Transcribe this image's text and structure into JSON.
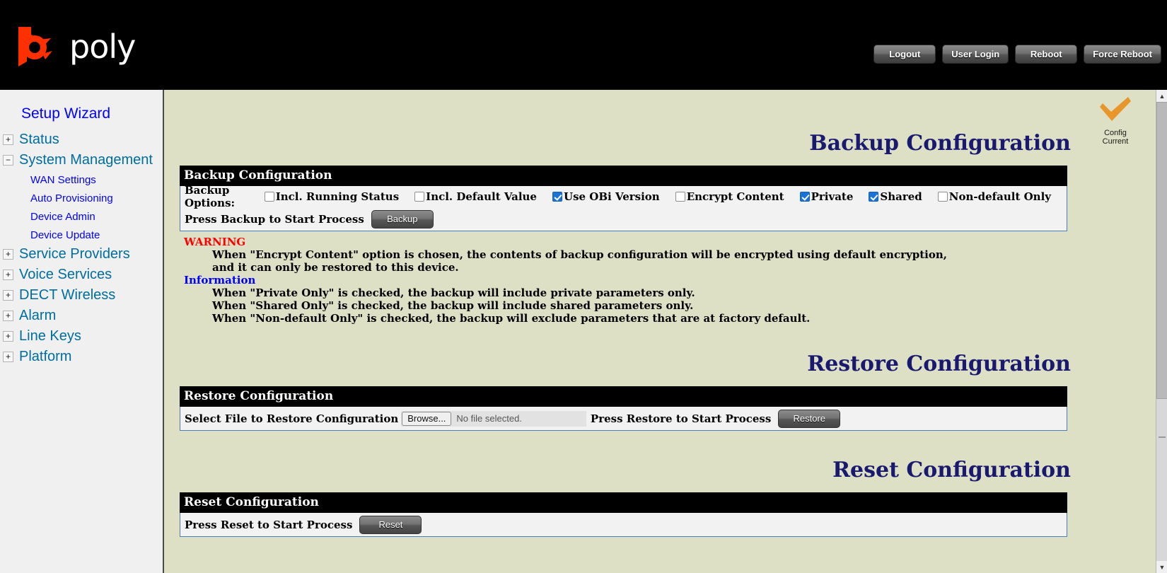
{
  "header": {
    "logo_text": "poly",
    "logo_icon": "poly-logo-icon",
    "buttons": [
      {
        "label": "Logout",
        "name": "logout-button"
      },
      {
        "label": "User Login",
        "name": "user-login-button"
      },
      {
        "label": "Reboot",
        "name": "reboot-button"
      },
      {
        "label": "Force Reboot",
        "name": "force-reboot-button"
      }
    ]
  },
  "sidebar": {
    "wizard": "Setup Wizard",
    "groups": [
      {
        "toggle": "+",
        "label": "Status"
      },
      {
        "toggle": "−",
        "label": "System Management"
      },
      {
        "toggle": "+",
        "label": "Service Providers"
      },
      {
        "toggle": "+",
        "label": "Voice Services"
      },
      {
        "toggle": "+",
        "label": "DECT Wireless"
      },
      {
        "toggle": "+",
        "label": "Alarm"
      },
      {
        "toggle": "+",
        "label": "Line Keys"
      },
      {
        "toggle": "+",
        "label": "Platform"
      }
    ],
    "system_management_items": [
      "WAN Settings",
      "Auto Provisioning",
      "Device Admin",
      "Device Update"
    ]
  },
  "status_badge": {
    "icon": "checkmark-icon",
    "line1": "Config",
    "line2": "Current",
    "color": "#e8962c"
  },
  "backup": {
    "page_title": "Backup Configuration",
    "panel_title": "Backup Configuration",
    "options_label": "Backup Options:",
    "options": [
      {
        "label": "Incl. Running Status",
        "checked": false,
        "name": "checkbox-incl-running-status"
      },
      {
        "label": "Incl. Default Value",
        "checked": false,
        "name": "checkbox-incl-default-value"
      },
      {
        "label": "Use OBi Version",
        "checked": true,
        "name": "checkbox-use-obi-version"
      },
      {
        "label": "Encrypt Content",
        "checked": false,
        "name": "checkbox-encrypt-content"
      },
      {
        "label": "Private",
        "checked": true,
        "name": "checkbox-private"
      },
      {
        "label": "Shared",
        "checked": true,
        "name": "checkbox-shared"
      },
      {
        "label": "Non-default Only",
        "checked": false,
        "name": "checkbox-non-default-only"
      }
    ],
    "action_label": "Press Backup to Start Process",
    "action_button": "Backup",
    "warning_head": "WARNING",
    "warning_lines": [
      "When \"Encrypt Content\" option is chosen, the contents of backup configuration will be encrypted using default encryption,",
      "and it can only be restored to this device."
    ],
    "information_head": "Information",
    "information_lines": [
      "When \"Private Only\" is checked, the backup will include private parameters only.",
      "When \"Shared Only\" is checked, the backup will include shared parameters only.",
      "When \"Non-default Only\" is checked, the backup will exclude parameters that are at factory default."
    ]
  },
  "restore": {
    "page_title": "Restore Configuration",
    "panel_title": "Restore Configuration",
    "select_label": "Select File to Restore Configuration",
    "browse_button": "Browse...",
    "file_name": "No file selected.",
    "action_label": "Press Restore to Start Process",
    "action_button": "Restore"
  },
  "reset": {
    "page_title": "Reset Configuration",
    "panel_title": "Reset Configuration",
    "action_label": "Press Reset to Start Process",
    "action_button": "Reset"
  },
  "scrollbar": {
    "up_arrow": "▲",
    "down_arrow": "▼"
  }
}
